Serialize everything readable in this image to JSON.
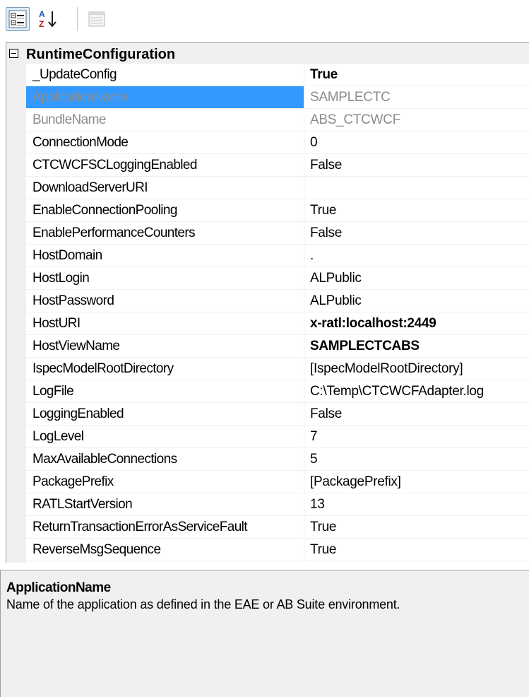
{
  "toolbar": {
    "categorized_icon": "categorized-icon",
    "alphabetical_icon": "alphabetical-icon",
    "alphabetical_glyph": "AZ",
    "property_pages_icon": "property-pages-icon"
  },
  "category": {
    "label": "RuntimeConfiguration"
  },
  "properties": [
    {
      "name": "_UpdateConfig",
      "value": "True"
    },
    {
      "name": "ApplicationName",
      "value": "SAMPLECTC"
    },
    {
      "name": "BundleName",
      "value": "ABS_CTCWCF"
    },
    {
      "name": "ConnectionMode",
      "value": "0"
    },
    {
      "name": "CTCWCFSCLoggingEnabled",
      "value": "False"
    },
    {
      "name": "DownloadServerURI",
      "value": ""
    },
    {
      "name": "EnableConnectionPooling",
      "value": "True"
    },
    {
      "name": "EnablePerformanceCounters",
      "value": "False"
    },
    {
      "name": "HostDomain",
      "value": "."
    },
    {
      "name": "HostLogin",
      "value": "ALPublic"
    },
    {
      "name": "HostPassword",
      "value": "ALPublic"
    },
    {
      "name": "HostURI",
      "value": "x-ratl:localhost:2449"
    },
    {
      "name": "HostViewName",
      "value": "SAMPLECTCABS"
    },
    {
      "name": "IspecModelRootDirectory",
      "value": "[IspecModelRootDirectory]"
    },
    {
      "name": "LogFile",
      "value": "C:\\Temp\\CTCWCFAdapter.log"
    },
    {
      "name": "LoggingEnabled",
      "value": "False"
    },
    {
      "name": "LogLevel",
      "value": "7"
    },
    {
      "name": "MaxAvailableConnections",
      "value": "5"
    },
    {
      "name": "PackagePrefix",
      "value": "[PackagePrefix]"
    },
    {
      "name": "RATLStartVersion",
      "value": "13"
    },
    {
      "name": "ReturnTransactionErrorAsServiceFault",
      "value": "True"
    },
    {
      "name": "ReverseMsgSequence",
      "value": "True"
    }
  ],
  "description": {
    "title": "ApplicationName",
    "text": "Name of the application as defined in the EAE or AB Suite environment."
  },
  "colors": {
    "selection": "#3399ff",
    "gutter": "#f0f0f0",
    "readonly_text": "#8c8c8c"
  }
}
